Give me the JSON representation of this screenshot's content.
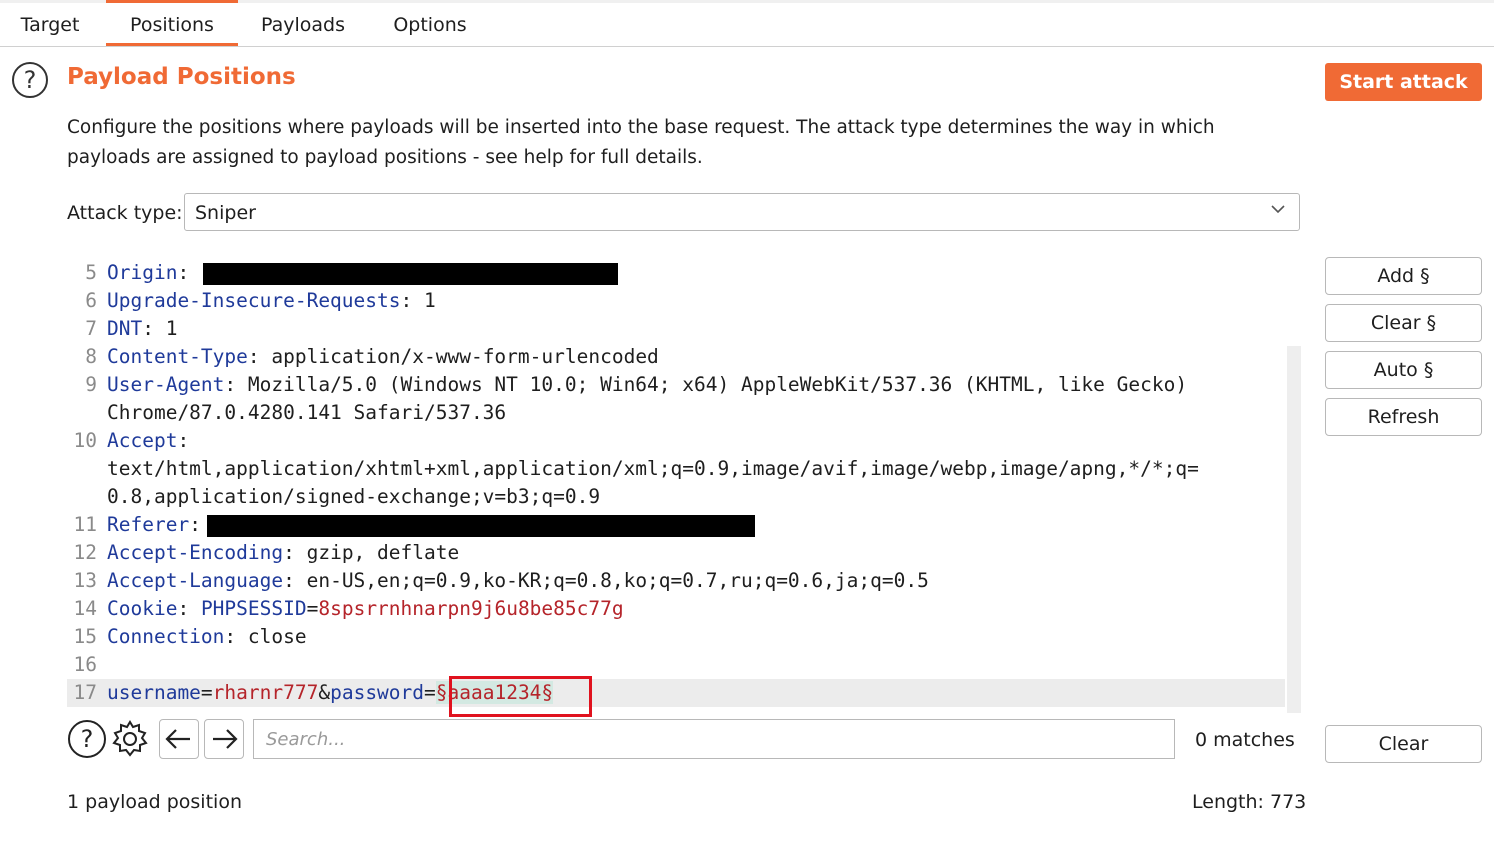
{
  "tabs": [
    {
      "label": "Target"
    },
    {
      "label": "Positions"
    },
    {
      "label": "Payloads"
    },
    {
      "label": "Options"
    }
  ],
  "section": {
    "title": "Payload Positions",
    "description": "Configure the positions where payloads will be inserted into the base request. The attack type determines the way in which payloads are assigned to payload positions - see help for full details."
  },
  "start_attack_label": "Start attack",
  "attack_type": {
    "label": "Attack type:",
    "value": "Sniper"
  },
  "editor": {
    "lines": [
      {
        "num": "5",
        "key": "Origin",
        "sep": ": ",
        "val": ""
      },
      {
        "num": "6",
        "key": "Upgrade-Insecure-Requests",
        "sep": ": ",
        "val": "1"
      },
      {
        "num": "7",
        "key": "DNT",
        "sep": ": ",
        "val": "1"
      },
      {
        "num": "8",
        "key": "Content-Type",
        "sep": ": ",
        "val": "application/x-www-form-urlencoded"
      },
      {
        "num": "9",
        "key": "User-Agent",
        "sep": ": ",
        "val": "Mozilla/5.0 (Windows NT 10.0; Win64; x64) AppleWebKit/537.36 (KHTML, like Gecko)"
      },
      {
        "num": "",
        "key": "",
        "sep": "",
        "val": "Chrome/87.0.4280.141 Safari/537.36"
      },
      {
        "num": "10",
        "key": "Accept",
        "sep": ":",
        "val": ""
      },
      {
        "num": "",
        "key": "",
        "sep": "",
        "val": "text/html,application/xhtml+xml,application/xml;q=0.9,image/avif,image/webp,image/apng,*/*;q="
      },
      {
        "num": "",
        "key": "",
        "sep": "",
        "val": "0.8,application/signed-exchange;v=b3;q=0.9"
      },
      {
        "num": "11",
        "key": "Referer",
        "sep": ":",
        "val": ""
      },
      {
        "num": "12",
        "key": "Accept-Encoding",
        "sep": ": ",
        "val": "gzip, deflate"
      },
      {
        "num": "13",
        "key": "Accept-Language",
        "sep": ": ",
        "val": "en-US,en;q=0.9,ko-KR;q=0.8,ko;q=0.7,ru;q=0.6,ja;q=0.5"
      },
      {
        "num": "16",
        "key": "",
        "sep": "",
        "val": ""
      }
    ],
    "cookie": {
      "num": "14",
      "key": "Cookie",
      "name": "PHPSESSID",
      "eq": "=",
      "value": "8spsrrnhnarpn9j6u8be85c77g"
    },
    "connection": {
      "num": "15",
      "key": "Connection",
      "sep": ": ",
      "val": "close"
    },
    "body": {
      "num": "17",
      "p1": "username",
      "eq1": "=",
      "v1": "rharnr777",
      "amp": "&",
      "p2": "password",
      "eq2": "=",
      "payload": "§aaaa1234§"
    }
  },
  "side_buttons": {
    "add": "Add §",
    "clear": "Clear §",
    "auto": "Auto §",
    "refresh": "Refresh",
    "clear_bottom": "Clear"
  },
  "search": {
    "placeholder": "Search...",
    "matches": "0 matches"
  },
  "footer": {
    "positions": "1 payload position",
    "length": "Length: 773"
  },
  "colors": {
    "accent": "#f06a35",
    "header_key": "#1f3a9a",
    "param_value": "#b5242a",
    "payload_bg": "#d3e9e2",
    "highlight_box": "#e0121e"
  }
}
